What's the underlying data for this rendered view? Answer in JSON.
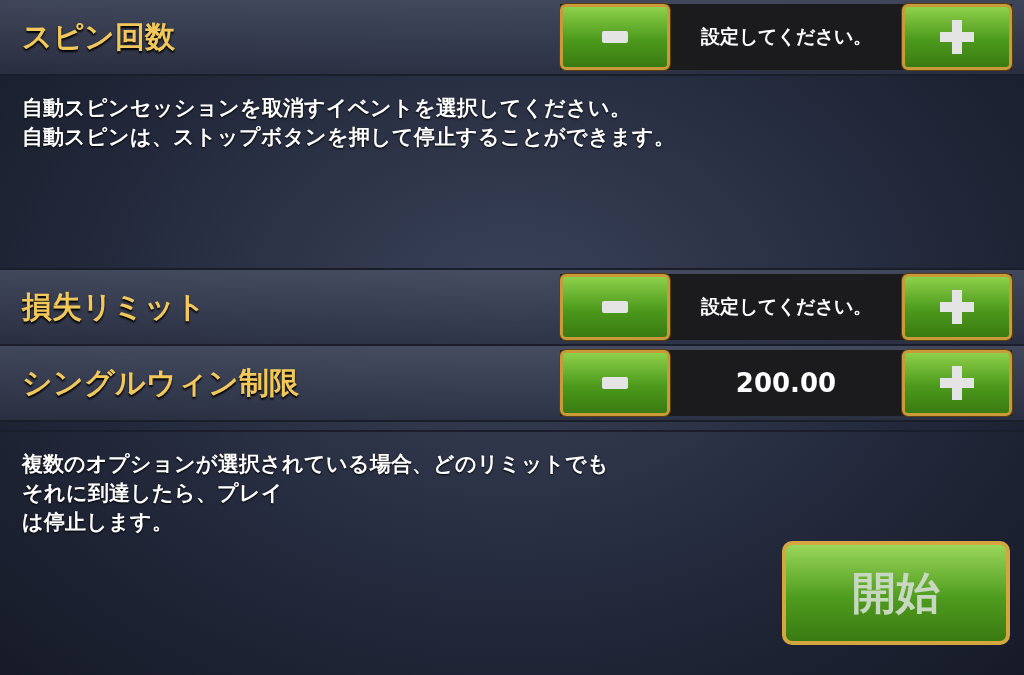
{
  "settings": [
    {
      "label": "スピン回数",
      "value": "設定してください。",
      "kind": "stepper"
    },
    {
      "label": "損失リミット",
      "value": "設定してください。",
      "kind": "stepper"
    },
    {
      "label": "シングルウィン制限",
      "value": "200.00",
      "kind": "stepper"
    }
  ],
  "description": [
    "自動スピンセッションを取消すイベントを選択してください。",
    "自動スピンは、ストップボタンを押して停止することができます。"
  ],
  "note": [
    "複数のオプションが選択されている場合、どのリミットでも",
    "それに到達したら、プレイ",
    "は停止します。"
  ],
  "start_button": "開始"
}
